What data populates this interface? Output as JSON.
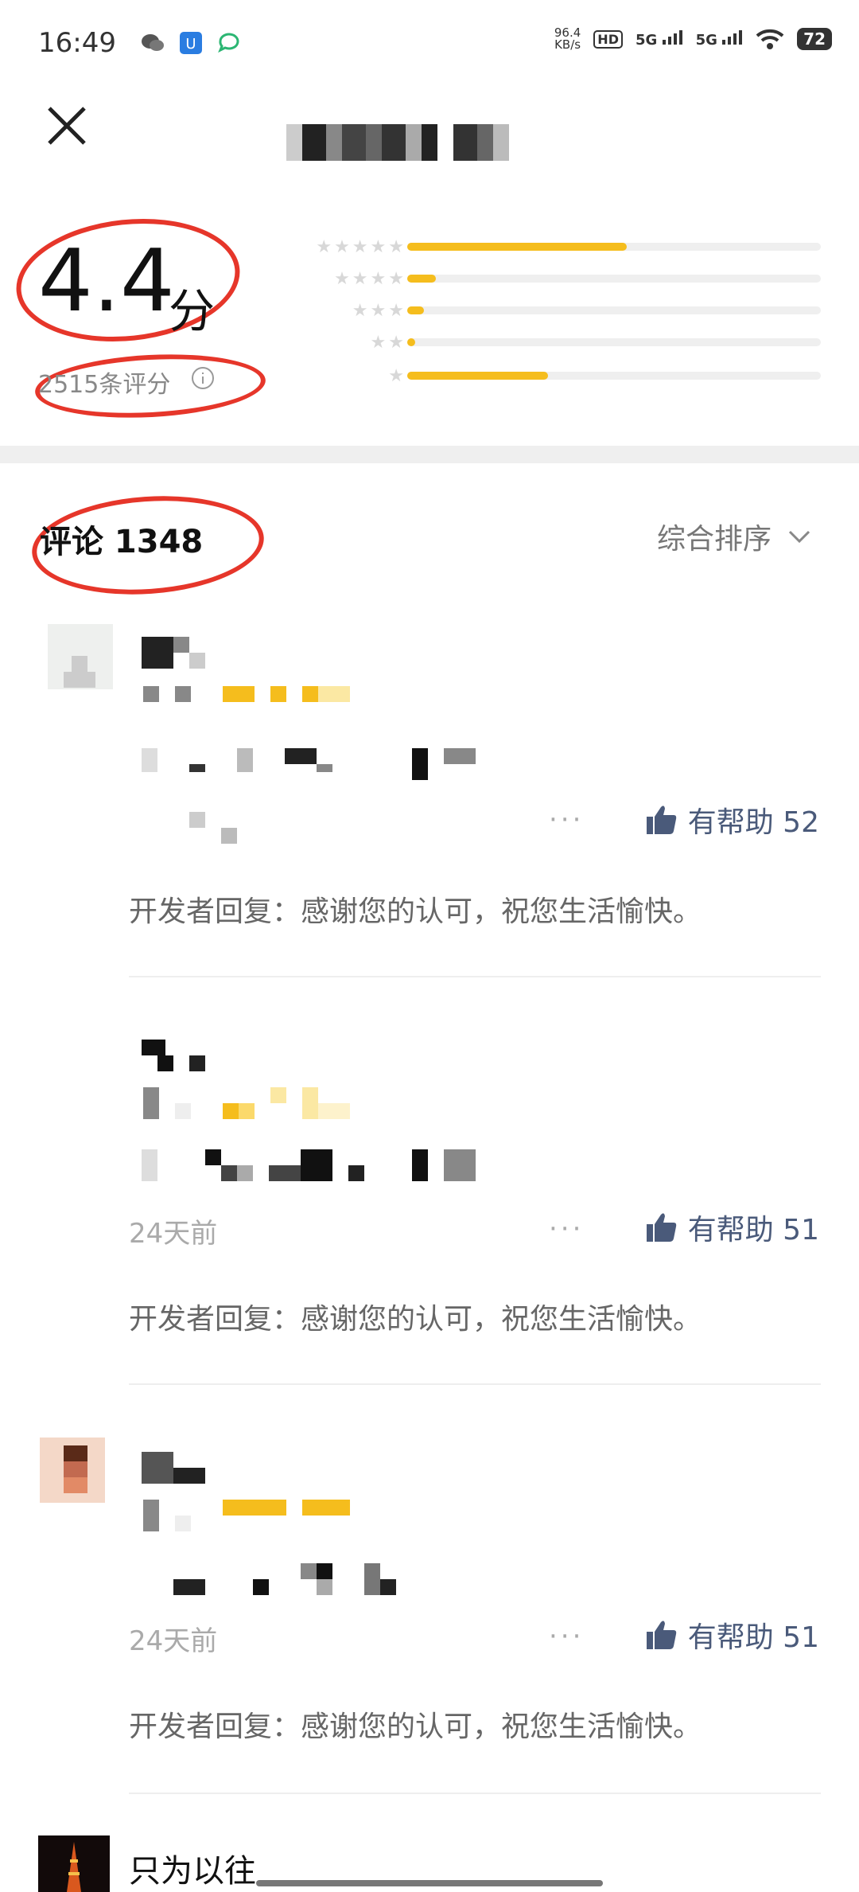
{
  "status_bar": {
    "time": "16:49",
    "net_speed_value": "96.4",
    "net_speed_unit": "KB/s",
    "hd_badge": "HD",
    "net1": "5G",
    "net2": "5G",
    "battery": "72"
  },
  "rating": {
    "score": "4.4",
    "unit": "分",
    "count_text": "2515条评分",
    "distribution": [
      {
        "stars": 5,
        "fraction": 0.53
      },
      {
        "stars": 4,
        "fraction": 0.07
      },
      {
        "stars": 3,
        "fraction": 0.04
      },
      {
        "stars": 2,
        "fraction": 0.02
      },
      {
        "stars": 1,
        "fraction": 0.34
      }
    ]
  },
  "reviews_header": {
    "title": "评论 1348",
    "sort_label": "综合排序"
  },
  "reviews": [
    {
      "date": "",
      "more": "···",
      "helpful_label": "有帮助 52",
      "dev_reply": "开发者回复：感谢您的认可，祝您生活愉快。"
    },
    {
      "date": "24天前",
      "more": "···",
      "helpful_label": "有帮助 51",
      "dev_reply": "开发者回复：感谢您的认可，祝您生活愉快。"
    },
    {
      "date": "24天前",
      "more": "···",
      "helpful_label": "有帮助 51",
      "dev_reply": "开发者回复：感谢您的认可，祝您生活愉快。"
    }
  ],
  "last_review": {
    "username": "只为以往"
  },
  "colors": {
    "accent_star": "#f5bd1d",
    "annotation_red": "#e6362a",
    "helpful_blue": "#4a5a7a"
  }
}
